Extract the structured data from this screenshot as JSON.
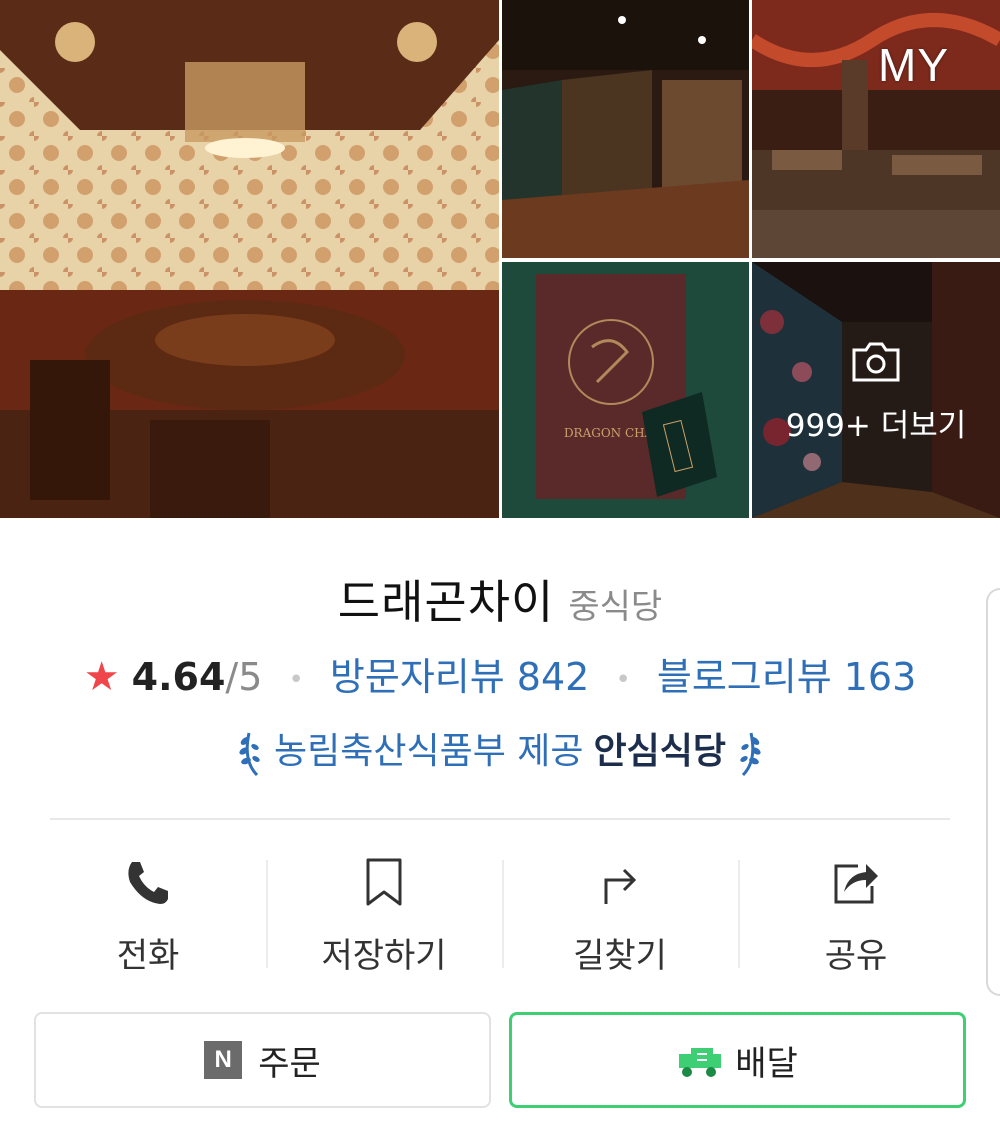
{
  "gallery": {
    "my_badge": "MY",
    "more_label": "999+ 더보기",
    "menu_brand": "DRAGON CHAI"
  },
  "place": {
    "name": "드래곤차이",
    "category": "중식당"
  },
  "rating": {
    "score": "4.64",
    "max": "/5",
    "visitor_reviews": "방문자리뷰 842",
    "blog_reviews": "블로그리뷰 163",
    "star_color": "#f0454a"
  },
  "certification": {
    "provider": "농림축산식품부 제공",
    "label": "안심식당"
  },
  "actions": {
    "call": "전화",
    "save": "저장하기",
    "directions": "길찾기",
    "share": "공유"
  },
  "buttons": {
    "order": "주문",
    "order_logo": "N",
    "delivery": "배달"
  },
  "colors": {
    "link": "#2f6fb8",
    "delivery_border": "#3ecf74"
  }
}
